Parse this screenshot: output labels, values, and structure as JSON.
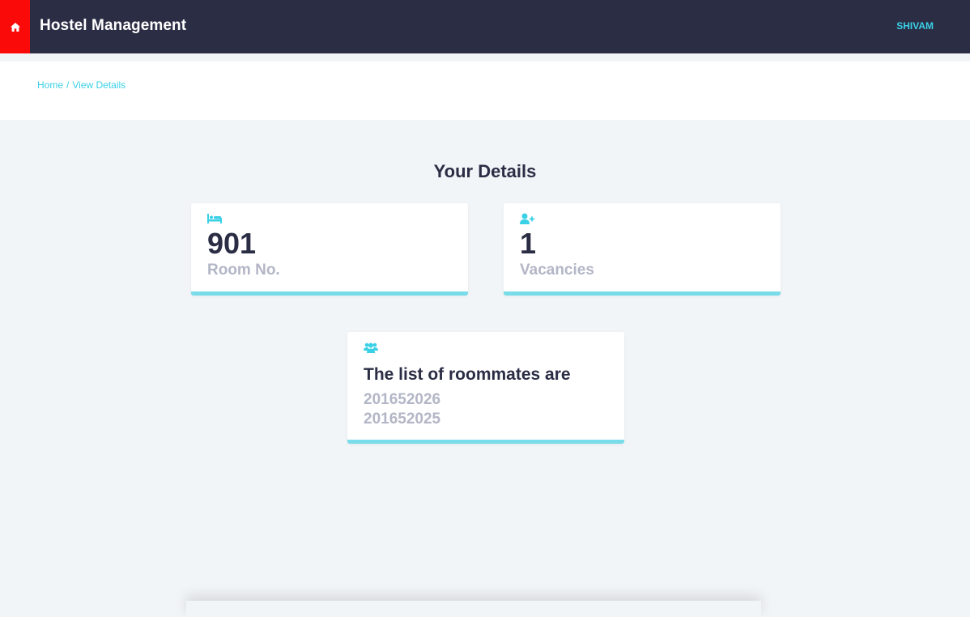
{
  "header": {
    "title": "Hostel Management",
    "user": "SHIVAM",
    "home_icon": "home-icon",
    "colors": {
      "bar": "#2b2d45",
      "home": "#fb0a0a",
      "accent": "#3ad0e6"
    }
  },
  "breadcrumb": {
    "home": "Home",
    "separator": "/",
    "current": "View Details"
  },
  "main": {
    "title": "Your Details",
    "room": {
      "icon": "bed-icon",
      "value": "901",
      "label": "Room No."
    },
    "vacancies": {
      "icon": "user-plus-icon",
      "value": "1",
      "label": "Vacancies"
    },
    "roommates": {
      "icon": "users-icon",
      "title": "The list of roommates are",
      "items": [
        "201652026",
        "201652025"
      ]
    }
  }
}
